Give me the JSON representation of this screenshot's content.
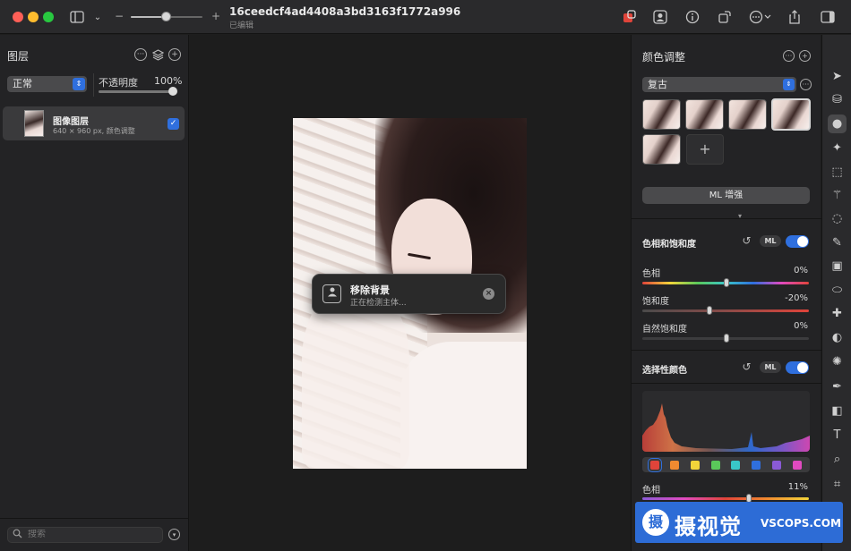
{
  "window": {
    "title": "16ceedcf4ad4408a3bd3163f1772a996",
    "subtitle": "已编辑"
  },
  "toolbar": {
    "zoom_minus": "−",
    "zoom_plus": "+",
    "zoom_level": 0.45
  },
  "layers_panel": {
    "title": "图层",
    "blend_mode": "正常",
    "opacity_label": "不透明度",
    "opacity_value": "100%",
    "opacity_level": 1.0,
    "layers": [
      {
        "name": "图像图层",
        "info": "640 × 960 px, 颜色调整",
        "visible": true
      }
    ],
    "search_placeholder": "搜索"
  },
  "toast": {
    "title": "移除背景",
    "subtitle": "正在检测主体..."
  },
  "adjust_panel": {
    "title": "颜色调整",
    "preset": "复古",
    "ml_button": "ML 增强",
    "sections": {
      "hue_sat": {
        "title": "色相和饱和度",
        "ml_badge": "ML",
        "enabled": true,
        "sliders": [
          {
            "label": "色相",
            "value": "0%"
          },
          {
            "label": "饱和度",
            "value": "-20%"
          },
          {
            "label": "自然饱和度",
            "value": "0%"
          }
        ]
      },
      "selective": {
        "title": "选择性颜色",
        "ml_badge": "ML",
        "enabled": true,
        "slider": {
          "label": "色相",
          "value": "11%"
        }
      }
    },
    "swatch_colors": [
      "#e0443a",
      "#f08a30",
      "#f2d43a",
      "#5ac85a",
      "#39c6c8",
      "#2f6fde",
      "#8a5ad6",
      "#e04ac0"
    ]
  },
  "watermark": {
    "logo_char": "摄",
    "cn_text": "摄视觉",
    "en_text": "VSCOPS.COM"
  }
}
